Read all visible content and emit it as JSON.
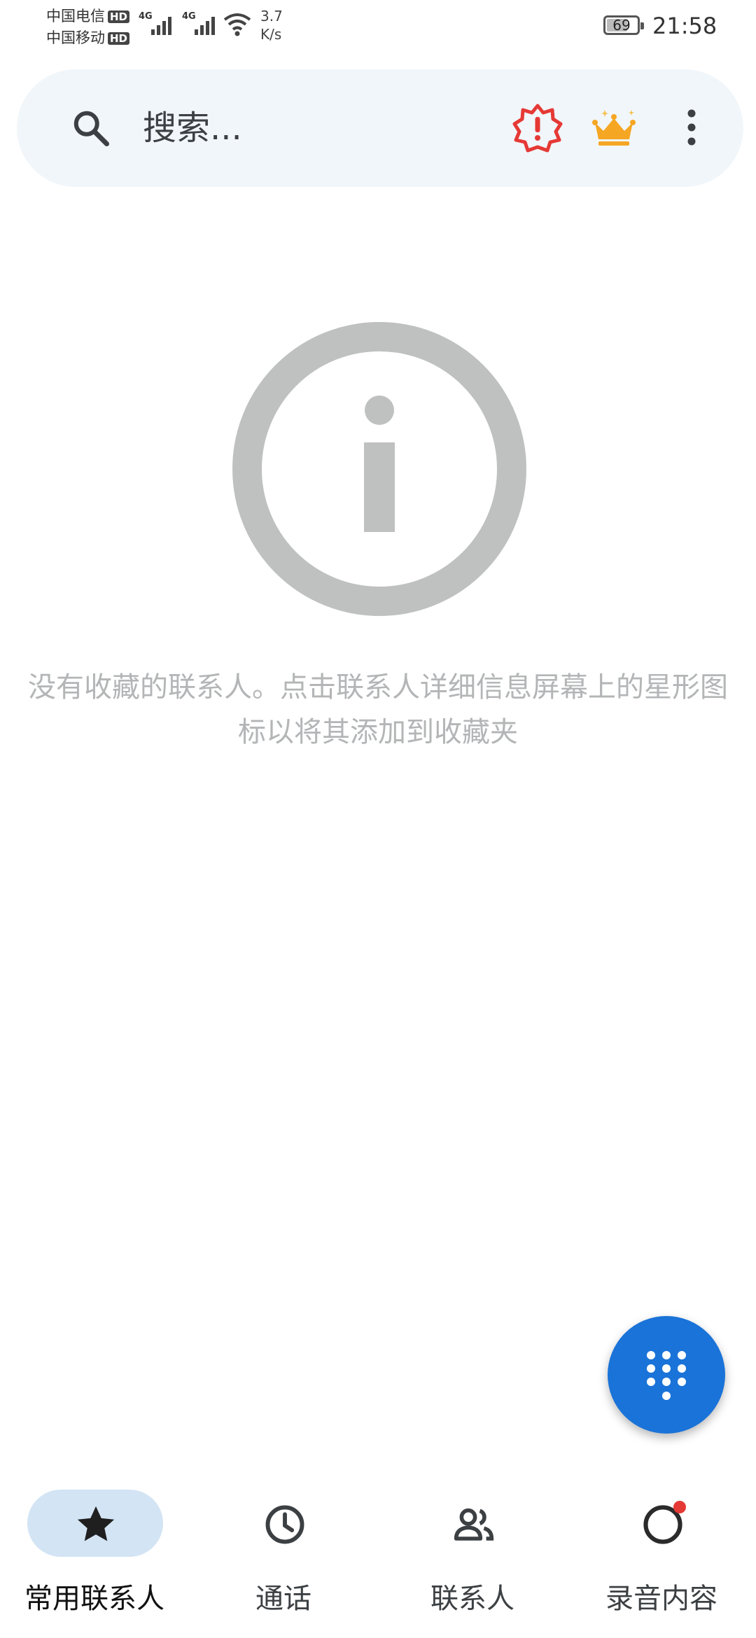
{
  "status_bar": {
    "carrier1": "中国电信",
    "carrier2": "中国移动",
    "hd_badge": "HD",
    "network_type": "4G",
    "speed_value": "3.7",
    "speed_unit": "K/s",
    "battery": "69",
    "battery_level": 0.69,
    "time": "21:58"
  },
  "search": {
    "placeholder": "搜索..."
  },
  "empty_state": {
    "message": "没有收藏的联系人。点击联系人详细信息屏幕上的星形图标以将其添加到收藏夹"
  },
  "bottom_nav": {
    "items": [
      {
        "label": "常用联系人",
        "icon": "star-icon",
        "active": true
      },
      {
        "label": "通话",
        "icon": "clock-icon",
        "active": false
      },
      {
        "label": "联系人",
        "icon": "people-icon",
        "active": false
      },
      {
        "label": "录音内容",
        "icon": "record-icon",
        "active": false,
        "badge": true
      }
    ]
  },
  "colors": {
    "accent": "#1a73d8",
    "search_bg": "#f1f6fa",
    "nav_active_bg": "#d3e4f4",
    "alert": "#e53935",
    "crown": "#f5a623",
    "illustration": "#bfc1c1"
  }
}
